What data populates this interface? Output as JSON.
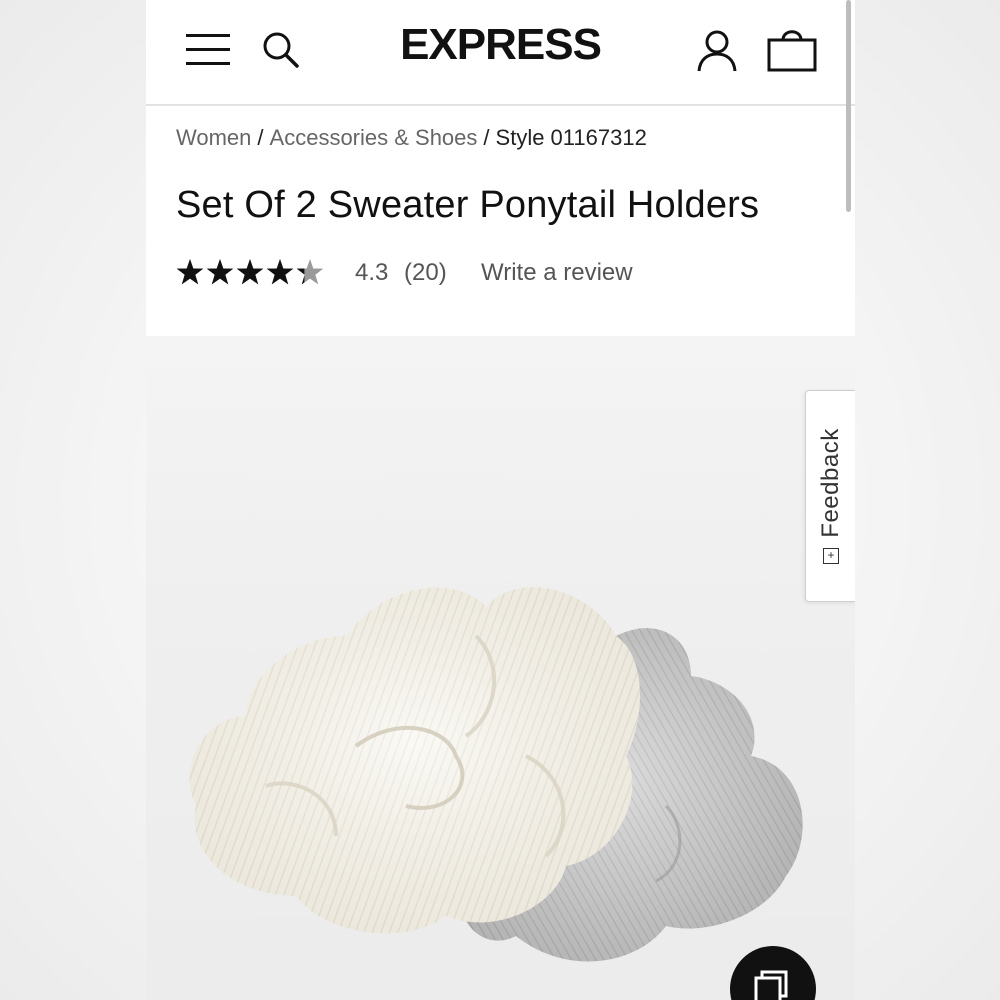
{
  "header": {
    "logo": "EXPRESS",
    "icons": [
      "menu-icon",
      "search-icon",
      "account-icon",
      "shopping-bag-icon"
    ]
  },
  "breadcrumb": {
    "items": [
      "Women",
      "Accessories & Shoes"
    ],
    "separator": "/",
    "current": "Style 01167312"
  },
  "product": {
    "title": "Set Of 2 Sweater Ponytail Holders",
    "rating_value": "4.3",
    "rating_count": "(20)",
    "stars_filled": 4.3,
    "stars_total": 5,
    "write_review": "Write a review",
    "image_icon": "product-photo-scrunchies"
  },
  "feedback": {
    "label": "Feedback",
    "icon": "plus-box-icon"
  },
  "fab": {
    "icon": "gallery-icon"
  },
  "colors": {
    "text": "#111111",
    "muted": "#555555",
    "star": "#111111",
    "star_empty": "#9a9a9a",
    "fab_bg": "#111111"
  }
}
